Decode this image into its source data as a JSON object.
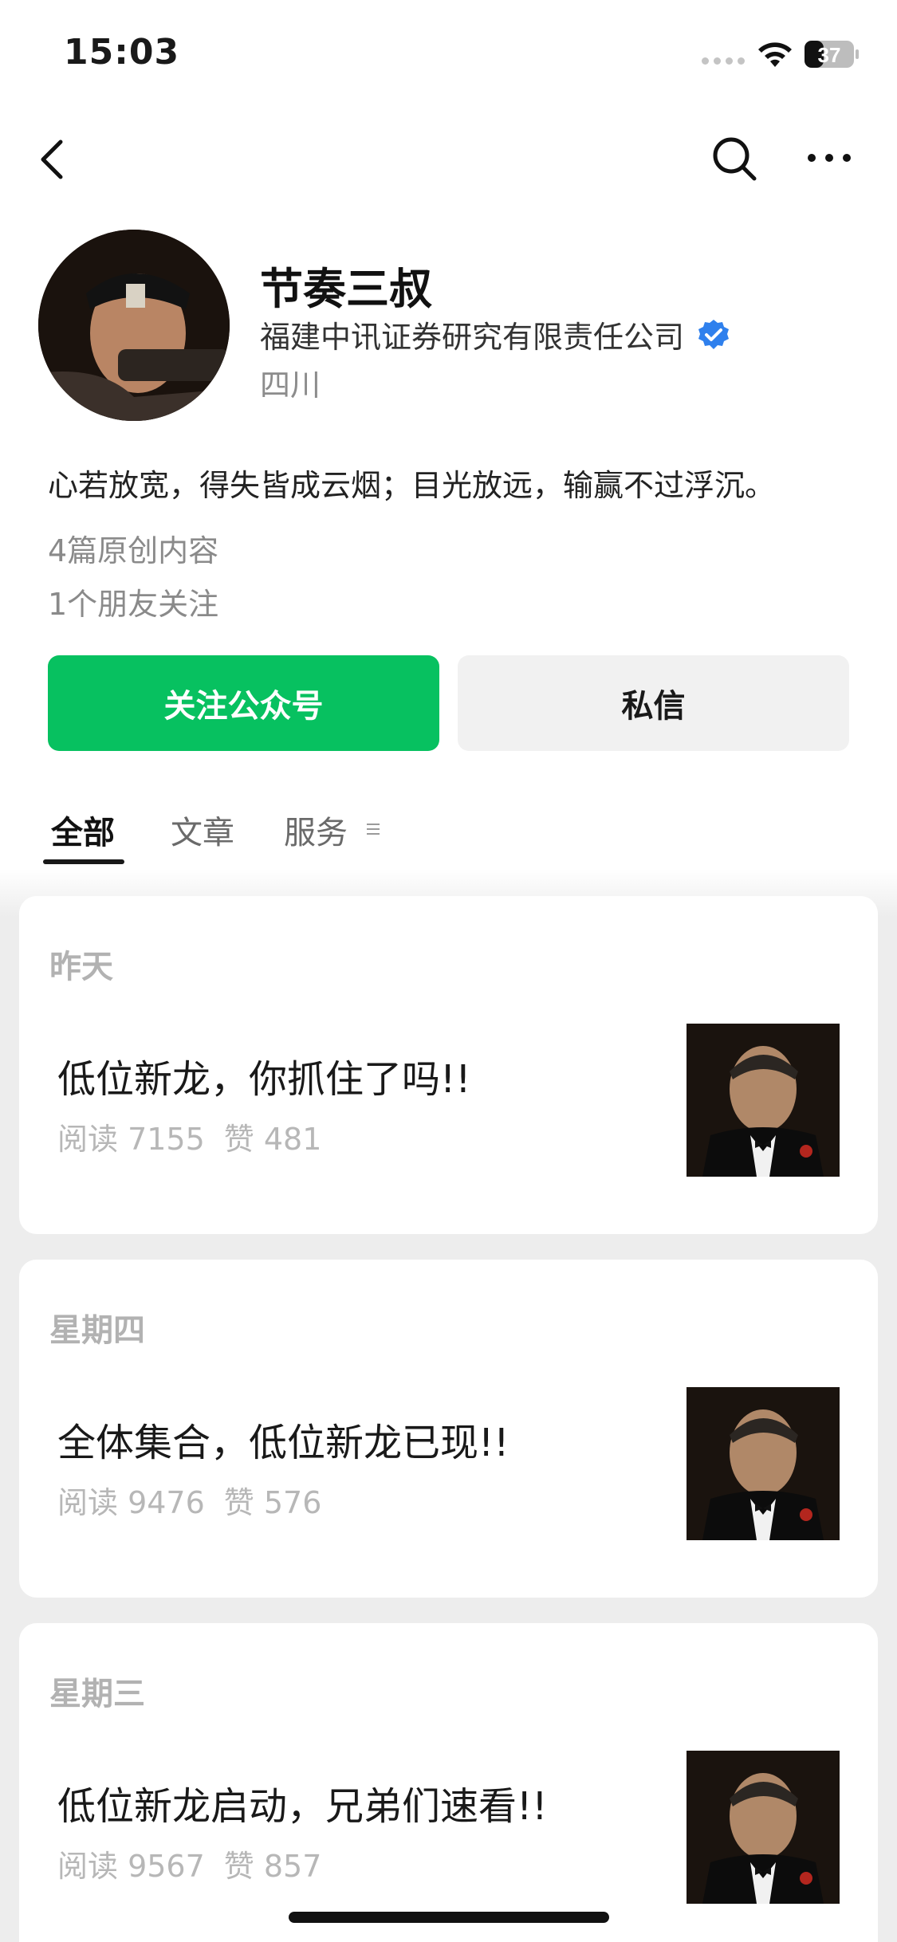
{
  "status_bar": {
    "time": "15:03",
    "battery": "37"
  },
  "profile": {
    "name": "节奏三叔",
    "organization": "福建中讯证券研究有限责任公司",
    "region": "四川",
    "bio": "心若放宽，得失皆成云烟；目光放远，输赢不过浮沉。",
    "original_count": "4篇原创内容",
    "friends_following": "1个朋友关注"
  },
  "actions": {
    "follow_label": "关注公众号",
    "message_label": "私信"
  },
  "tabs": [
    {
      "label": "全部",
      "selected": true
    },
    {
      "label": "文章",
      "selected": false
    },
    {
      "label": "服务",
      "selected": false
    }
  ],
  "articles": [
    {
      "date": "昨天",
      "title": "低位新龙，你抓住了吗!!",
      "reads": "阅读 7155",
      "likes": "赞 481"
    },
    {
      "date": "星期四",
      "title": "全体集合，低位新龙已现!!",
      "reads": "阅读 9476",
      "likes": "赞 576"
    },
    {
      "date": "星期三",
      "title": "低位新龙启动，兄弟们速看!!",
      "reads": "阅读 9567",
      "likes": "赞 857"
    }
  ],
  "colors": {
    "accent_green": "#07c160",
    "verified_blue": "#2f80ed"
  }
}
